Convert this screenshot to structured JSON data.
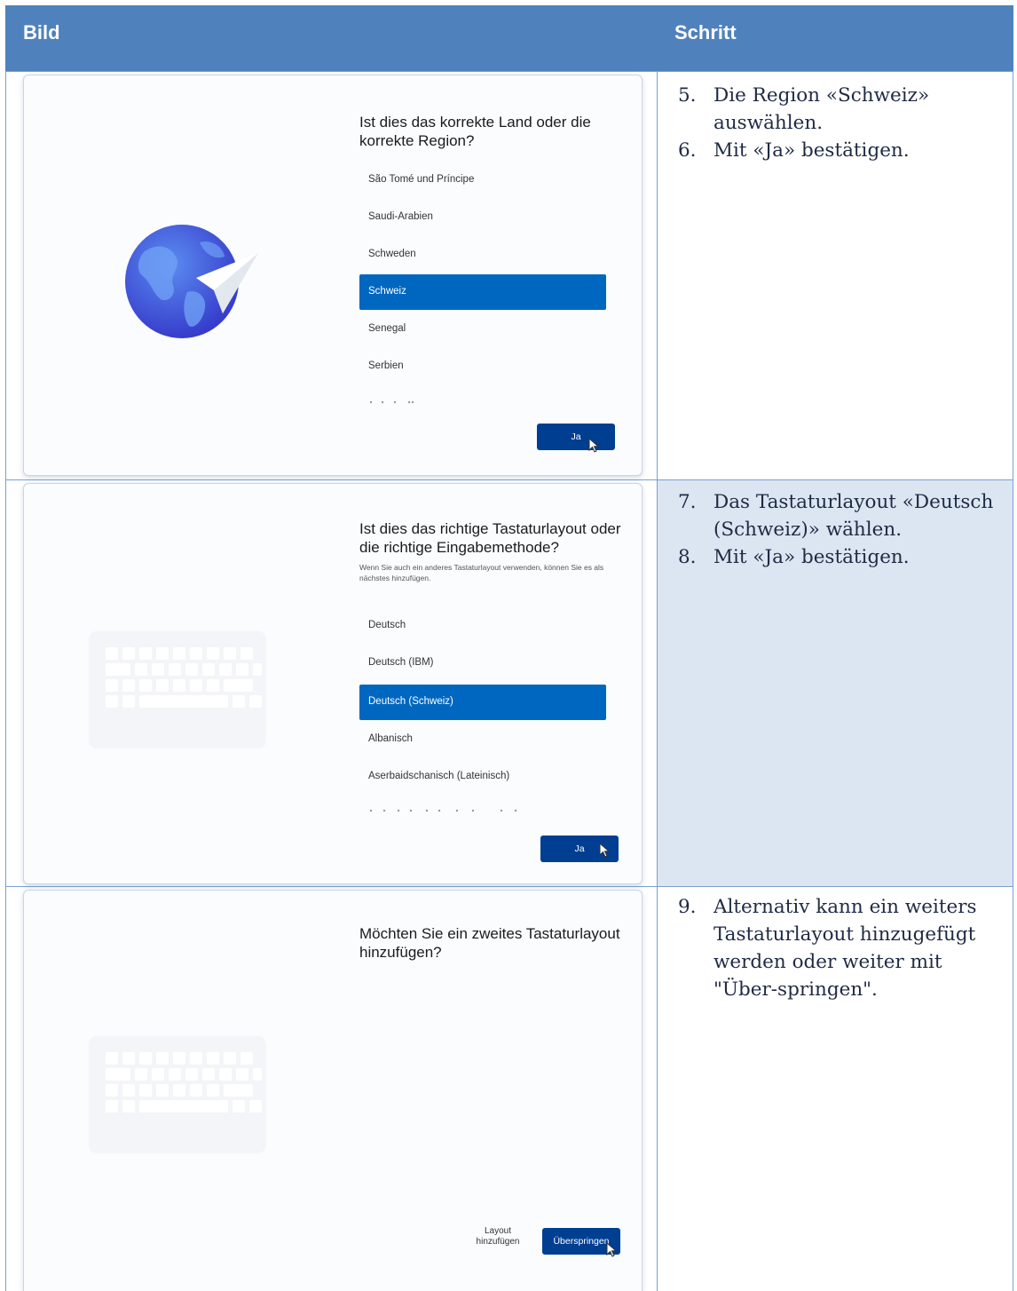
{
  "header": {
    "col1": "Bild",
    "col2": "Schritt"
  },
  "rows": [
    {
      "steps": [
        {
          "num": "5.",
          "text": "Die Region «Schweiz» auswählen."
        },
        {
          "num": "6.",
          "text": "Mit «Ja» bestätigen."
        }
      ],
      "screen": {
        "title": "Ist dies das korrekte Land oder die korrekte Region?",
        "options": [
          "São Tomé und Príncipe",
          "Saudi-Arabien",
          "Schweden",
          "Schweiz",
          "Senegal",
          "Serbien"
        ],
        "selected_index": 3,
        "button": "Ja",
        "illustration": "globe-paper-plane-icon"
      }
    },
    {
      "steps": [
        {
          "num": "7.",
          "text": "Das Tastaturlayout «Deutsch (Schweiz)» wählen."
        },
        {
          "num": "8.",
          "text": "Mit «Ja» bestätigen."
        }
      ],
      "screen": {
        "title": "Ist dies das richtige Tastaturlayout oder die richtige Eingabemethode?",
        "subtitle": "Wenn Sie auch ein anderes Tastaturlayout verwenden, können Sie es als nächstes hinzufügen.",
        "options": [
          "Deutsch",
          "Deutsch (IBM)",
          "Deutsch (Schweiz)",
          "Albanisch",
          "Aserbaidschanisch (Lateinisch)"
        ],
        "selected_index": 2,
        "button": "Ja",
        "illustration": "keyboard-icon"
      }
    },
    {
      "steps": [
        {
          "num": "9.",
          "text": "Alternativ kann ein weiters Tastaturlayout hinzugefügt werden oder weiter mit \"Über-springen\"."
        }
      ],
      "screen": {
        "back": "←",
        "title": "Möchten Sie ein zweites Tastaturlayout hinzufügen?",
        "secondary_button": "Layout hinzufügen",
        "button": "Überspringen",
        "illustration": "keyboard-icon"
      }
    }
  ],
  "colors": {
    "header_bg": "#4f81bd",
    "row_alt_bg": "#dce6f2",
    "accent": "#0067c0",
    "button": "#003e92"
  }
}
